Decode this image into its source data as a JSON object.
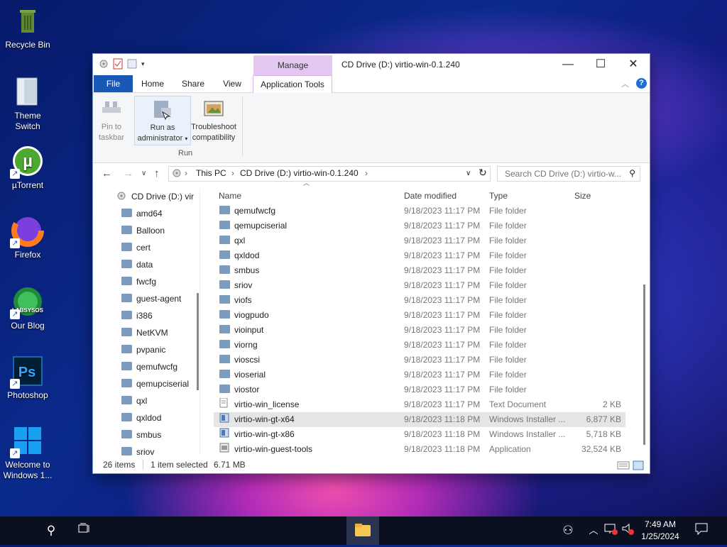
{
  "desktop": {
    "icons": [
      {
        "label": "Recycle Bin",
        "icon": "recycle-bin-icon"
      },
      {
        "label": "Theme Switch",
        "icon": "theme-switch-icon"
      },
      {
        "label": "µTorrent",
        "icon": "utorrent-icon"
      },
      {
        "label": "Firefox",
        "icon": "firefox-icon"
      },
      {
        "label": "Our Blog",
        "icon": "blog-icon"
      },
      {
        "label": "Photoshop",
        "icon": "photoshop-icon"
      },
      {
        "label": "Welcome to Windows 1...",
        "icon": "windows-logo-icon"
      }
    ]
  },
  "window": {
    "title": "CD Drive (D:) virtio-win-0.1.240",
    "contextual_tab_group": "Manage",
    "tabs": [
      "File",
      "Home",
      "Share",
      "View",
      "Application Tools"
    ],
    "active_tab": "Application Tools",
    "ribbon": {
      "pin_label": "Pin to taskbar",
      "run_admin_line1": "Run as",
      "run_admin_line2": "administrator",
      "troubleshoot_line1": "Troubleshoot",
      "troubleshoot_line2": "compatibility",
      "group_label": "Run"
    },
    "address": {
      "crumb1": "This PC",
      "crumb2": "CD Drive (D:) virtio-win-0.1.240"
    },
    "search_placeholder": "Search CD Drive (D:) virtio-w...",
    "navpane": [
      "CD Drive (D:) vir",
      "amd64",
      "Balloon",
      "cert",
      "data",
      "fwcfg",
      "guest-agent",
      "i386",
      "NetKVM",
      "pvpanic",
      "qemufwcfg",
      "qemupciserial",
      "qxl",
      "qxldod",
      "smbus",
      "sriov"
    ],
    "columns": {
      "name": "Name",
      "date": "Date modified",
      "type": "Type",
      "size": "Size"
    },
    "files": [
      {
        "name": "qemufwcfg",
        "date": "9/18/2023 11:17 PM",
        "type": "File folder",
        "size": "",
        "kind": "folder"
      },
      {
        "name": "qemupciserial",
        "date": "9/18/2023 11:17 PM",
        "type": "File folder",
        "size": "",
        "kind": "folder"
      },
      {
        "name": "qxl",
        "date": "9/18/2023 11:17 PM",
        "type": "File folder",
        "size": "",
        "kind": "folder"
      },
      {
        "name": "qxldod",
        "date": "9/18/2023 11:17 PM",
        "type": "File folder",
        "size": "",
        "kind": "folder"
      },
      {
        "name": "smbus",
        "date": "9/18/2023 11:17 PM",
        "type": "File folder",
        "size": "",
        "kind": "folder"
      },
      {
        "name": "sriov",
        "date": "9/18/2023 11:17 PM",
        "type": "File folder",
        "size": "",
        "kind": "folder"
      },
      {
        "name": "viofs",
        "date": "9/18/2023 11:17 PM",
        "type": "File folder",
        "size": "",
        "kind": "folder"
      },
      {
        "name": "viogpudo",
        "date": "9/18/2023 11:17 PM",
        "type": "File folder",
        "size": "",
        "kind": "folder"
      },
      {
        "name": "vioinput",
        "date": "9/18/2023 11:17 PM",
        "type": "File folder",
        "size": "",
        "kind": "folder"
      },
      {
        "name": "viorng",
        "date": "9/18/2023 11:17 PM",
        "type": "File folder",
        "size": "",
        "kind": "folder"
      },
      {
        "name": "vioscsi",
        "date": "9/18/2023 11:17 PM",
        "type": "File folder",
        "size": "",
        "kind": "folder"
      },
      {
        "name": "vioserial",
        "date": "9/18/2023 11:17 PM",
        "type": "File folder",
        "size": "",
        "kind": "folder"
      },
      {
        "name": "viostor",
        "date": "9/18/2023 11:17 PM",
        "type": "File folder",
        "size": "",
        "kind": "folder"
      },
      {
        "name": "virtio-win_license",
        "date": "9/18/2023 11:17 PM",
        "type": "Text Document",
        "size": "2 KB",
        "kind": "text"
      },
      {
        "name": "virtio-win-gt-x64",
        "date": "9/18/2023 11:18 PM",
        "type": "Windows Installer ...",
        "size": "6,877 KB",
        "kind": "msi",
        "selected": true
      },
      {
        "name": "virtio-win-gt-x86",
        "date": "9/18/2023 11:18 PM",
        "type": "Windows Installer ...",
        "size": "5,718 KB",
        "kind": "msi"
      },
      {
        "name": "virtio-win-guest-tools",
        "date": "9/18/2023 11:18 PM",
        "type": "Application",
        "size": "32,524 KB",
        "kind": "exe"
      }
    ],
    "status": {
      "items": "26 items",
      "selected": "1 item selected",
      "size": "6.71 MB"
    }
  },
  "taskbar": {
    "time": "7:49 AM",
    "date": "1/25/2024"
  },
  "colors": {
    "file_tab": "#1a58b8",
    "manage_tab": "#e4c8f2",
    "folder": "#7b9bbf"
  }
}
